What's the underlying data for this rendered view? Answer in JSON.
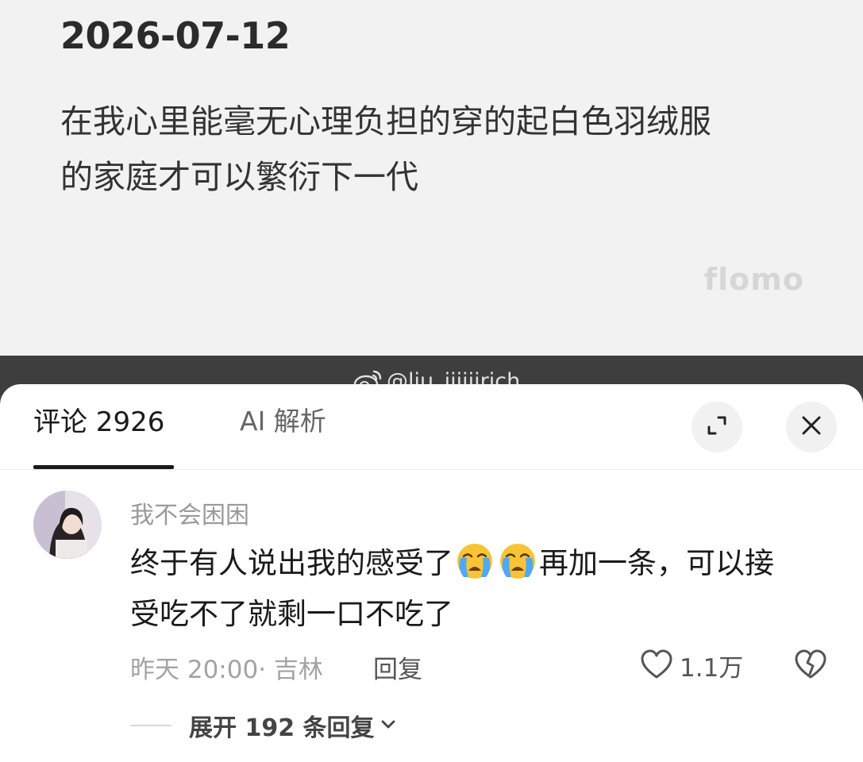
{
  "note": {
    "date": "2026-07-12",
    "text_line1": "在我心里能毫无心理负担的穿的起白色羽绒服",
    "text_line2": "的家庭才可以繁衍下一代",
    "brand": "flomo"
  },
  "watermark": {
    "handle": "@liu_iiiiiirich",
    "icon": "weibo-icon"
  },
  "sheet": {
    "tab_comments": "评论 2926",
    "tab_ai": "AI 解析",
    "expand_icon": "expand-icon",
    "close_icon": "close-icon"
  },
  "comment": {
    "username": "我不会困困",
    "text_part1": "终于有人说出我的感受了",
    "emoji": "loudly-crying-face",
    "text_part2": "再加一条，可以接",
    "text_line2": "受吃不了就剩一口不吃了",
    "meta": "昨天 20:00· 吉林",
    "reply_label": "回复",
    "like_count": "1.1万",
    "expand_replies": "展开 192 条回复"
  }
}
